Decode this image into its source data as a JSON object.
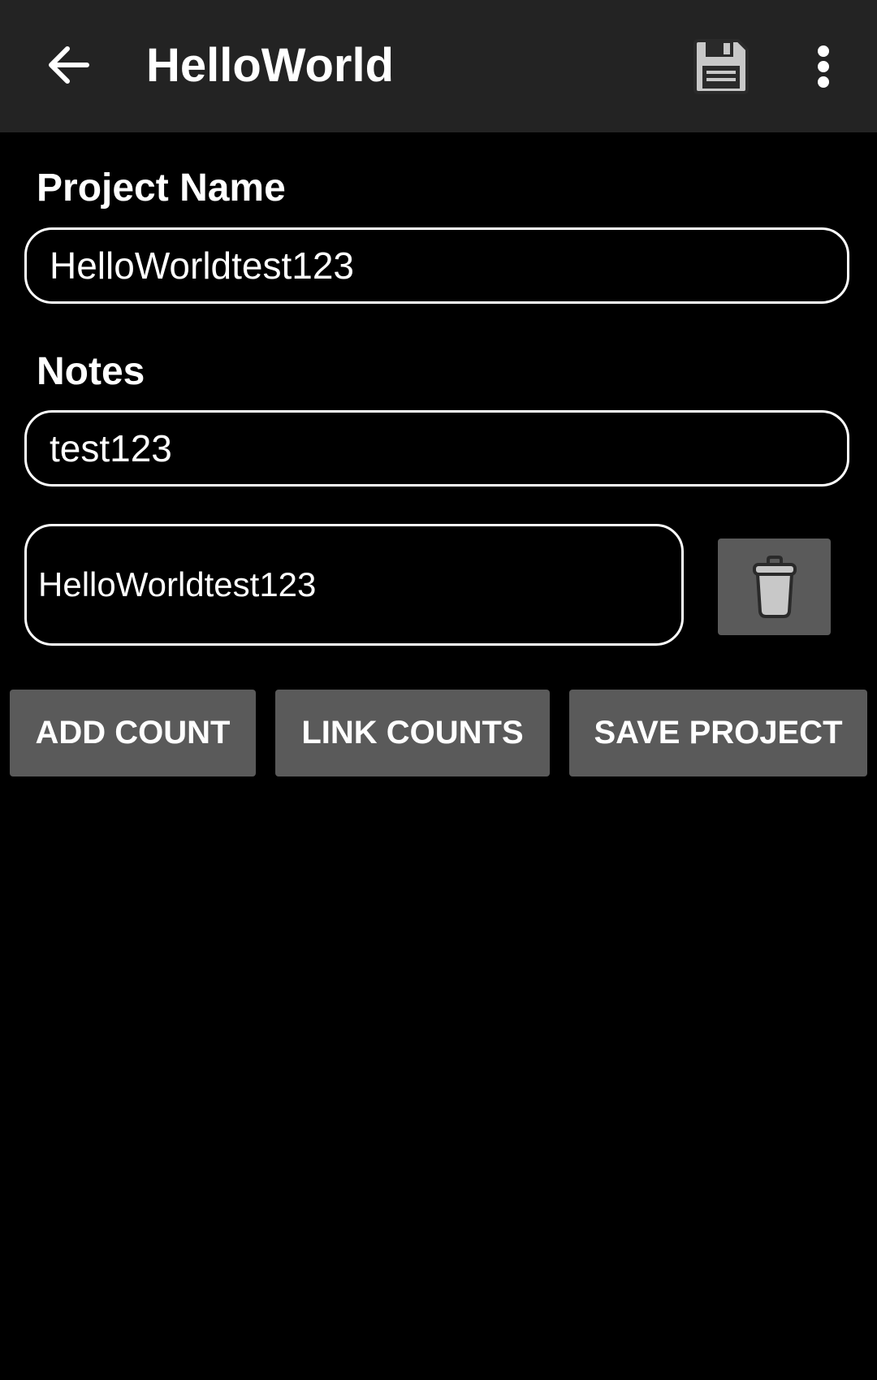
{
  "appbar": {
    "title": "HelloWorld",
    "back_icon": "arrow-back-icon",
    "save_icon": "floppy-disk-icon",
    "menu_icon": "more-vert-icon"
  },
  "form": {
    "project_name_label": "Project Name",
    "project_name_value": "HelloWorldtest123",
    "notes_label": "Notes",
    "notes_value": "test123"
  },
  "counts": [
    {
      "name": "HelloWorldtest123",
      "delete_icon": "trash-icon"
    }
  ],
  "actions": {
    "add_count": "ADD COUNT",
    "link_counts": "LINK COUNTS",
    "save_project": "SAVE PROJECT"
  },
  "colors": {
    "background": "#000000",
    "appbar": "#232323",
    "button": "#5a5a5a",
    "text": "#ffffff"
  }
}
